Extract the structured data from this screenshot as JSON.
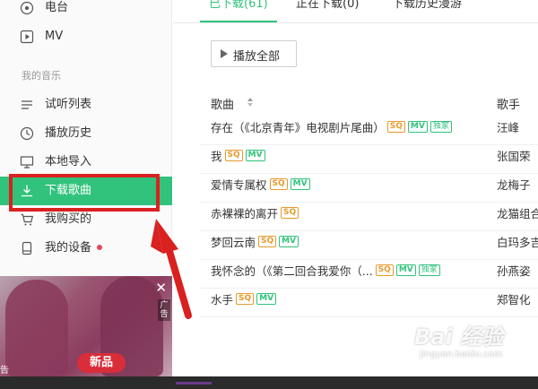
{
  "sidebar": {
    "items_top": [
      {
        "label": "电台",
        "icon": "radio-icon"
      },
      {
        "label": "MV",
        "icon": "mv-play-icon"
      }
    ],
    "section_label": "我的音乐",
    "items": [
      {
        "label": "试听列表",
        "icon": "list-icon"
      },
      {
        "label": "播放历史",
        "icon": "clock-icon"
      },
      {
        "label": "本地导入",
        "icon": "monitor-icon"
      },
      {
        "label": "下载歌曲",
        "icon": "download-icon",
        "active": true
      },
      {
        "label": "我购买的",
        "icon": "cart-icon"
      },
      {
        "label": "我的设备",
        "icon": "device-icon"
      }
    ]
  },
  "ad": {
    "close_glyph": "✕",
    "tag": "广告",
    "badge": "新品",
    "corner_label": "告"
  },
  "tabs": [
    {
      "label": "已下载(61)",
      "active": true
    },
    {
      "label": "正在下载(0)",
      "active": false
    },
    {
      "label": "下载历史漫游",
      "active": false
    }
  ],
  "play_all_label": "播放全部",
  "columns": {
    "song": "歌曲",
    "singer": "歌手"
  },
  "songs": [
    {
      "title": "存在（《北京青年》电视剧片尾曲）",
      "badges": [
        "SQ",
        "MV",
        "独家"
      ],
      "singer": "汪峰"
    },
    {
      "title": "我",
      "badges": [
        "SQ",
        "MV"
      ],
      "singer": "张国荣"
    },
    {
      "title": "爱情专属权",
      "badges": [
        "SQ",
        "MV"
      ],
      "singer": "龙梅子"
    },
    {
      "title": "赤裸裸的离开",
      "badges": [
        "SQ"
      ],
      "singer": "龙猫组合"
    },
    {
      "title": "梦回云南",
      "badges": [
        "SQ",
        "MV"
      ],
      "singer": "白玛多吉"
    },
    {
      "title": "我怀念的（《第二回合我爱你（...",
      "badges": [
        "SQ",
        "MV",
        "独家"
      ],
      "singer": "孙燕姿"
    },
    {
      "title": "水手",
      "badges": [
        "SQ",
        "MV"
      ],
      "singer": "郑智化"
    }
  ],
  "watermark": {
    "text": "Bai 经验",
    "sub": "jingyan.baidu.com"
  },
  "colors": {
    "accent": "#31c27c",
    "highlight": "#d9211f",
    "sq": "#e79a2e"
  }
}
